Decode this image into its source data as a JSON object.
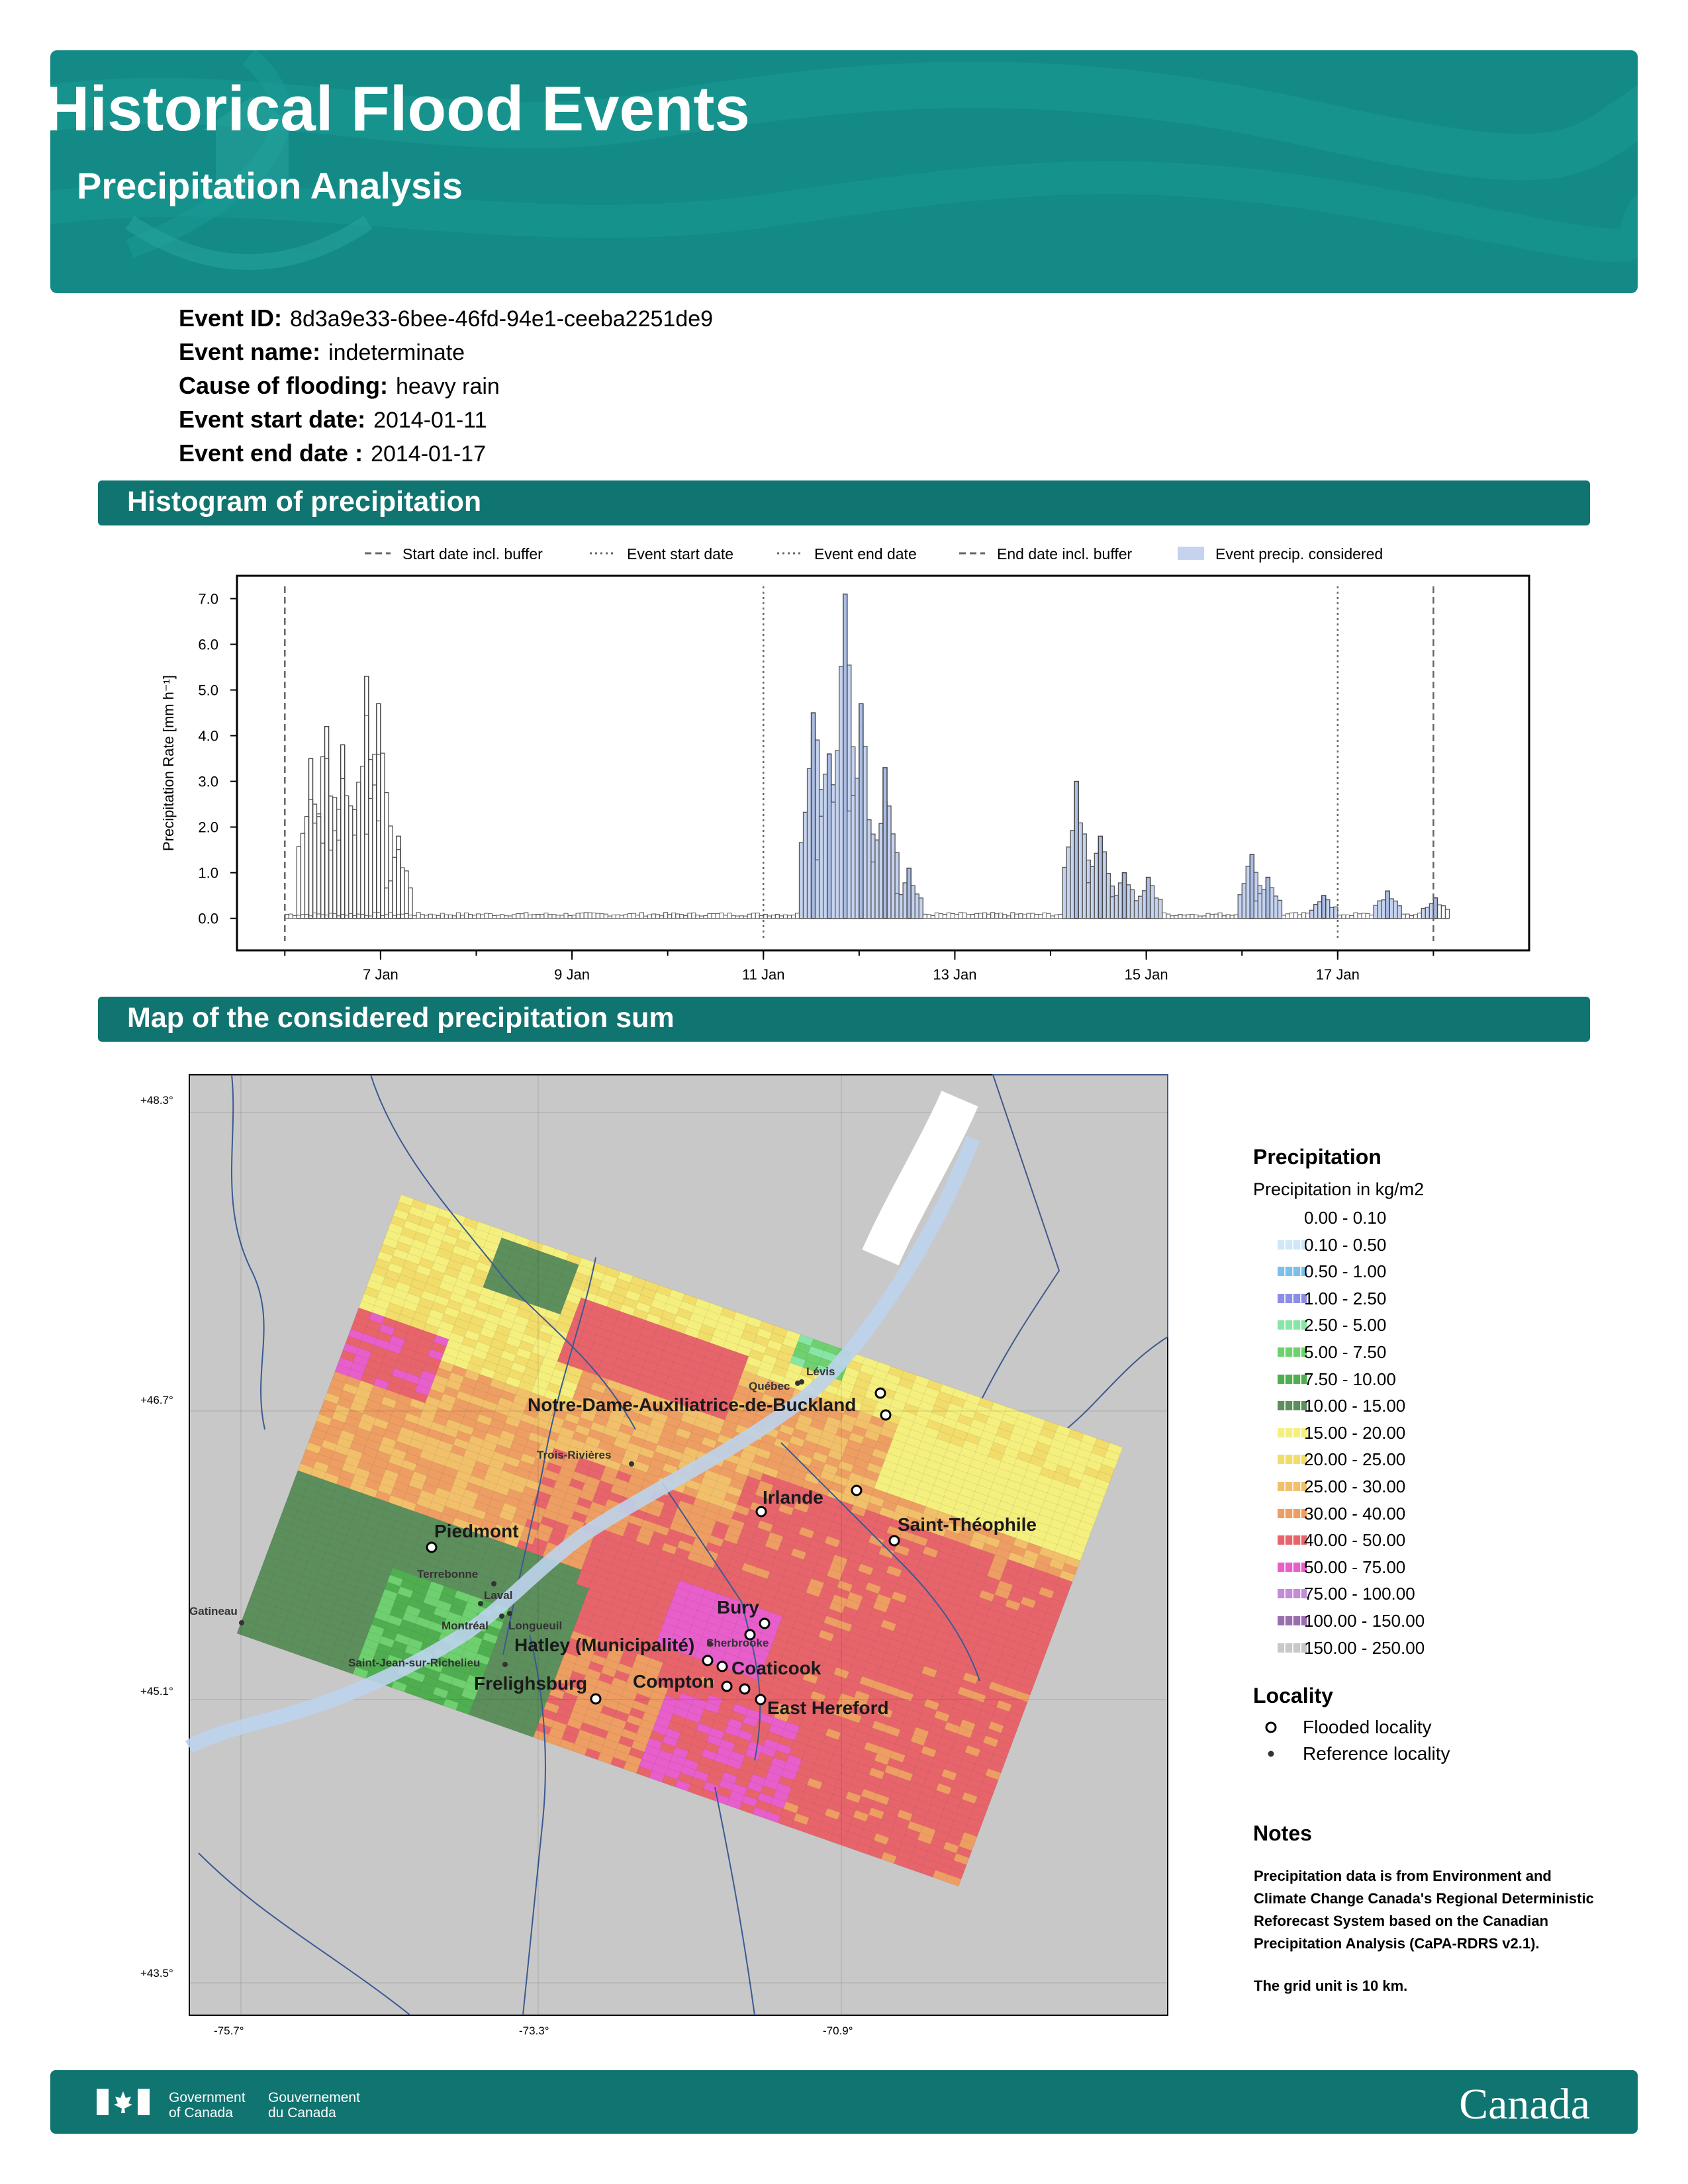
{
  "header": {
    "title": "Historical Flood Events",
    "subtitle": "Precipitation Analysis"
  },
  "event": [
    {
      "label": "Event ID:",
      "value": "8d3a9e33-6bee-46fd-94e1-ceeba2251de9"
    },
    {
      "label": "Event name:",
      "value": "indeterminate"
    },
    {
      "label": "Cause of flooding:",
      "value": "heavy rain"
    },
    {
      "label": "Event start date:",
      "value": "2014-01-11"
    },
    {
      "label": "Event end date :",
      "value": "2014-01-17"
    }
  ],
  "sections": {
    "histogram": "Histogram of precipitation",
    "map": "Map of the considered precipitation sum"
  },
  "chart_data": {
    "type": "bar",
    "ylabel": "Precipitation Rate [mm h⁻¹]",
    "ylim": [
      -0.7,
      7.5
    ],
    "yticks": [
      "0.0",
      "1.0",
      "2.0",
      "3.0",
      "4.0",
      "5.0",
      "6.0",
      "7.0"
    ],
    "xlim": [
      "2014-01-05 12:00",
      "2014-01-19 00:00"
    ],
    "xticks": [
      "7 Jan",
      "9 Jan",
      "11 Jan",
      "13 Jan",
      "15 Jan",
      "17 Jan"
    ],
    "legend": [
      {
        "label": "Start date incl. buffer",
        "style": "dashed"
      },
      {
        "label": "Event start date",
        "style": "dotted"
      },
      {
        "label": "Event end date",
        "style": "dotted"
      },
      {
        "label": "End date incl. buffer",
        "style": "dashed"
      },
      {
        "label": "Event precip. considered",
        "style": "patch",
        "color": "#c5d3ef"
      }
    ],
    "lines": [
      {
        "date": "2014-01-06 00:00",
        "style": "dashed"
      },
      {
        "date": "2014-01-11 00:00",
        "style": "dotted"
      },
      {
        "date": "2014-01-17 00:00",
        "style": "dotted"
      },
      {
        "date": "2014-01-18 00:00",
        "style": "dashed"
      }
    ],
    "peaks": [
      {
        "date": "2014-01-06 06:00",
        "value": 3.5
      },
      {
        "date": "2014-01-06 10:00",
        "value": 4.2
      },
      {
        "date": "2014-01-06 14:00",
        "value": 3.8
      },
      {
        "date": "2014-01-06 20:00",
        "value": 5.3
      },
      {
        "date": "2014-01-06 23:00",
        "value": 4.7
      },
      {
        "date": "2014-01-07 04:00",
        "value": 1.8
      },
      {
        "date": "2014-01-11 12:00",
        "value": 4.5
      },
      {
        "date": "2014-01-11 16:00",
        "value": 3.6
      },
      {
        "date": "2014-01-11 20:00",
        "value": 7.1
      },
      {
        "date": "2014-01-12 00:00",
        "value": 4.7
      },
      {
        "date": "2014-01-12 06:00",
        "value": 3.3
      },
      {
        "date": "2014-01-12 12:00",
        "value": 1.1
      },
      {
        "date": "2014-01-14 06:00",
        "value": 3.0
      },
      {
        "date": "2014-01-14 12:00",
        "value": 1.8
      },
      {
        "date": "2014-01-14 18:00",
        "value": 1.0
      },
      {
        "date": "2014-01-15 00:00",
        "value": 0.9
      },
      {
        "date": "2014-01-16 02:00",
        "value": 1.4
      },
      {
        "date": "2014-01-16 06:00",
        "value": 0.9
      },
      {
        "date": "2014-01-16 20:00",
        "value": 0.5
      },
      {
        "date": "2014-01-17 12:00",
        "value": 0.6
      },
      {
        "date": "2014-01-18 00:00",
        "value": 0.45
      }
    ]
  },
  "map": {
    "lat_labels": [
      "+48.3°",
      "+46.7°",
      "+45.1°",
      "+43.5°"
    ],
    "lon_labels": [
      "-75.7°",
      "-73.3°",
      "-70.9°"
    ],
    "flooded_localities": [
      "Notre-Dame-Auxiliatrice-de-Buckland",
      "Irlande",
      "Saint-Théophile",
      "Piedmont",
      "Bury",
      "Hatley (Municipalité)",
      "Coaticook",
      "Compton",
      "Frelighsburg",
      "East Hereford"
    ],
    "reference_localities": [
      "Lévis",
      "Québec",
      "Trois-Rivières",
      "Terrebonne",
      "Laval",
      "Montréal",
      "Longueuil",
      "Gatineau",
      "Saint-Jean-sur-Richelieu",
      "Sherbrooke"
    ]
  },
  "legend": {
    "title": "Precipitation",
    "subtitle": "Precipitation in kg/m2",
    "items": [
      {
        "label": "0.00 - 0.10",
        "color": "#ffffff"
      },
      {
        "label": "0.10 - 0.50",
        "color": "#cfe8f7"
      },
      {
        "label": "0.50 - 1.00",
        "color": "#7cc0ea"
      },
      {
        "label": "1.00 - 2.50",
        "color": "#8c8ee6"
      },
      {
        "label": "2.50 - 5.00",
        "color": "#87e6a6"
      },
      {
        "label": "5.00 - 7.50",
        "color": "#6ed06e"
      },
      {
        "label": "7.50 - 10.00",
        "color": "#4fae4f"
      },
      {
        "label": "10.00 - 15.00",
        "color": "#5c8f5c"
      },
      {
        "label": "15.00 - 20.00",
        "color": "#f5f07e"
      },
      {
        "label": "20.00 - 25.00",
        "color": "#f2dc6a"
      },
      {
        "label": "25.00 - 30.00",
        "color": "#f2c06a"
      },
      {
        "label": "30.00 - 40.00",
        "color": "#ee9e62"
      },
      {
        "label": "40.00 - 50.00",
        "color": "#e8646b"
      },
      {
        "label": "50.00 - 75.00",
        "color": "#e85ecb"
      },
      {
        "label": "75.00 - 100.00",
        "color": "#c38bd8"
      },
      {
        "label": "100.00 - 150.00",
        "color": "#9a6fb0"
      },
      {
        "label": "150.00 - 250.00",
        "color": "#c8c8c8"
      }
    ],
    "locality_title": "Locality",
    "flooded": "Flooded locality",
    "reference": "Reference locality"
  },
  "notes": {
    "title": "Notes",
    "p1": "Precipitation data is from Environment and Climate Change Canada's Regional Deterministic Reforecast System based on the Canadian Precipitation Analysis (CaPA-RDRS v2.1).",
    "p2": "The grid unit is 10 km."
  },
  "footer": {
    "gov_en_1": "Government",
    "gov_en_2": "of Canada",
    "gov_fr_1": "Gouvernement",
    "gov_fr_2": "du Canada",
    "wordmark": "Canada"
  }
}
